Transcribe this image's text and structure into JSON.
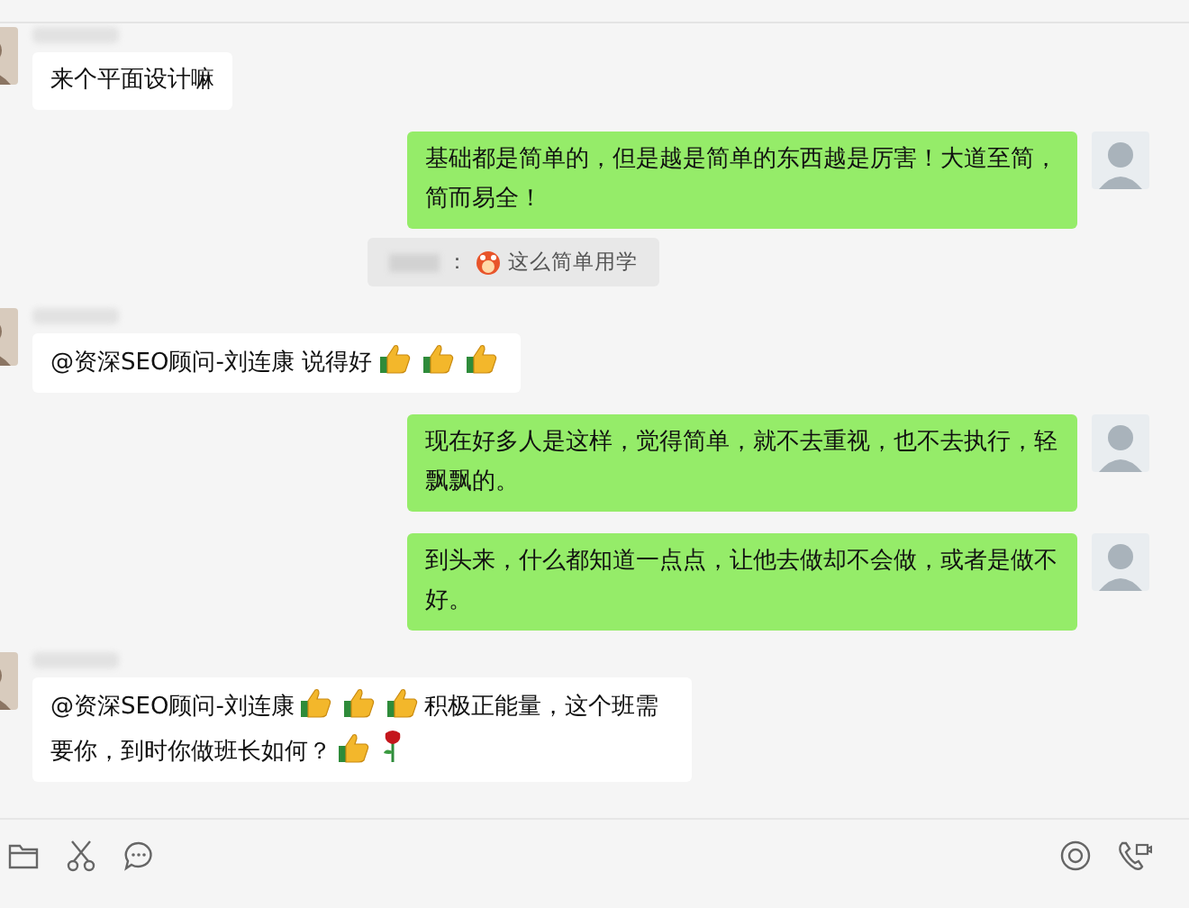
{
  "messages": [
    {
      "kind": "incoming",
      "sender_blurred": true,
      "parts": [
        {
          "kind": "text",
          "text": "来个平面设计嘛"
        }
      ]
    },
    {
      "kind": "outgoing",
      "parts": [
        {
          "kind": "text",
          "text": "基础都是简单的，但是越是简单的东西越是厉害！大道至简，简而易全！"
        }
      ],
      "quote": {
        "sender_blurred": true,
        "parts": [
          {
            "kind": "text",
            "text": "："
          },
          {
            "kind": "face"
          },
          {
            "kind": "text",
            "text": "这么简单用学"
          }
        ]
      }
    },
    {
      "kind": "incoming",
      "sender_blurred": true,
      "parts": [
        {
          "kind": "text",
          "text": "@资深SEO顾问-刘连康 说得好"
        },
        {
          "kind": "thumbs-up"
        },
        {
          "kind": "thumbs-up"
        },
        {
          "kind": "thumbs-up"
        }
      ]
    },
    {
      "kind": "outgoing",
      "parts": [
        {
          "kind": "text",
          "text": "现在好多人是这样，觉得简单，就不去重视，也不去执行，轻飘飘的。"
        }
      ]
    },
    {
      "kind": "outgoing",
      "parts": [
        {
          "kind": "text",
          "text": "到头来，什么都知道一点点，让他去做却不会做，或者是做不好。"
        }
      ]
    },
    {
      "kind": "incoming",
      "sender_blurred": true,
      "parts": [
        {
          "kind": "text",
          "text": "@资深SEO顾问-刘连康"
        },
        {
          "kind": "thumbs-up"
        },
        {
          "kind": "thumbs-up"
        },
        {
          "kind": "thumbs-up"
        },
        {
          "kind": "text",
          "text": "积极正能量，这个班需"
        },
        {
          "kind": "text",
          "text": "要你，到时你做班长如何？"
        },
        {
          "kind": "thumbs-up"
        },
        {
          "kind": "rose"
        }
      ]
    }
  ],
  "toolbar": [
    {
      "kind": "folder"
    },
    {
      "kind": "scissors"
    },
    {
      "kind": "chat"
    }
  ],
  "toolbar_right": [
    {
      "kind": "target"
    },
    {
      "kind": "phone"
    }
  ]
}
